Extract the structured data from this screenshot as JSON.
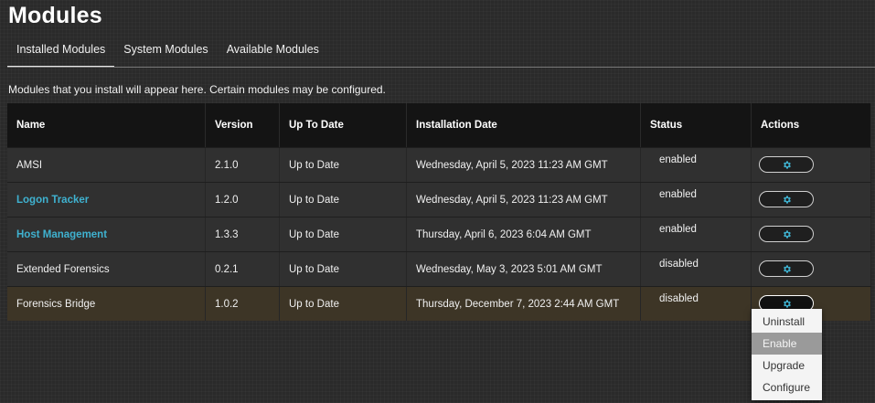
{
  "page": {
    "title": "Modules",
    "description": "Modules that you install will appear here. Certain modules may be configured."
  },
  "tabs": [
    {
      "label": "Installed Modules",
      "active": true
    },
    {
      "label": "System Modules",
      "active": false
    },
    {
      "label": "Available Modules",
      "active": false
    }
  ],
  "table": {
    "headers": {
      "name": "Name",
      "version": "Version",
      "up_to_date": "Up To Date",
      "installation_date": "Installation Date",
      "status": "Status",
      "actions": "Actions"
    },
    "rows": [
      {
        "name": "AMSI",
        "version": "2.1.0",
        "up_to_date": "Up to Date",
        "installation_date": "Wednesday, April 5, 2023 11:23 AM GMT",
        "status": "enabled"
      },
      {
        "name": "Logon Tracker",
        "version": "1.2.0",
        "up_to_date": "Up to Date",
        "installation_date": "Wednesday, April 5, 2023 11:23 AM GMT",
        "status": "enabled"
      },
      {
        "name": "Host Management",
        "version": "1.3.3",
        "up_to_date": "Up to Date",
        "installation_date": "Thursday, April 6, 2023 6:04 AM GMT",
        "status": "enabled"
      },
      {
        "name": "Extended Forensics",
        "version": "0.2.1",
        "up_to_date": "Up to Date",
        "installation_date": "Wednesday, May 3, 2023 5:01 AM GMT",
        "status": "disabled"
      },
      {
        "name": "Forensics Bridge",
        "version": "1.0.2",
        "up_to_date": "Up to Date",
        "installation_date": "Thursday, December 7, 2023 2:44 AM GMT",
        "status": "disabled"
      }
    ]
  },
  "actions_menu": {
    "items": [
      "Uninstall",
      "Enable",
      "Upgrade",
      "Configure"
    ],
    "hovered": "Enable"
  },
  "colors": {
    "link": "#3fb2d0",
    "highlight_row": "#3d3526",
    "header_bg": "#141414"
  },
  "icons": {
    "action_button": "gear-icon"
  }
}
